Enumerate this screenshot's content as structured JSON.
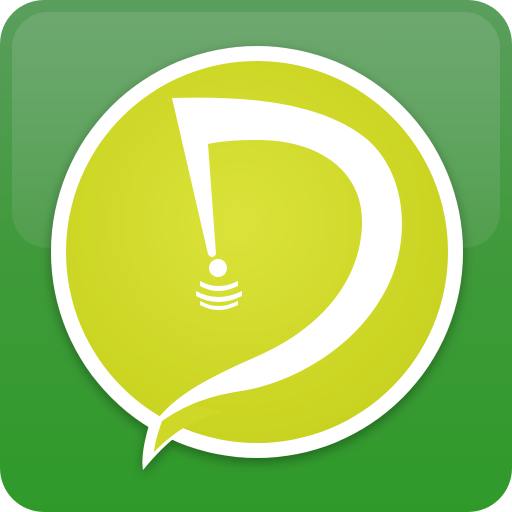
{
  "app_icon": {
    "icon": "speech-bubble-d-signal-icon",
    "colors": {
      "tile_top": "#5a9e5e",
      "tile_mid": "#3f9a3a",
      "tile_bottom": "#2f9a2a",
      "gloss": "#7fb07f",
      "badge_fill": "#d4dd2a",
      "badge_inner": "#cfd826",
      "outline": "#ffffff"
    }
  }
}
